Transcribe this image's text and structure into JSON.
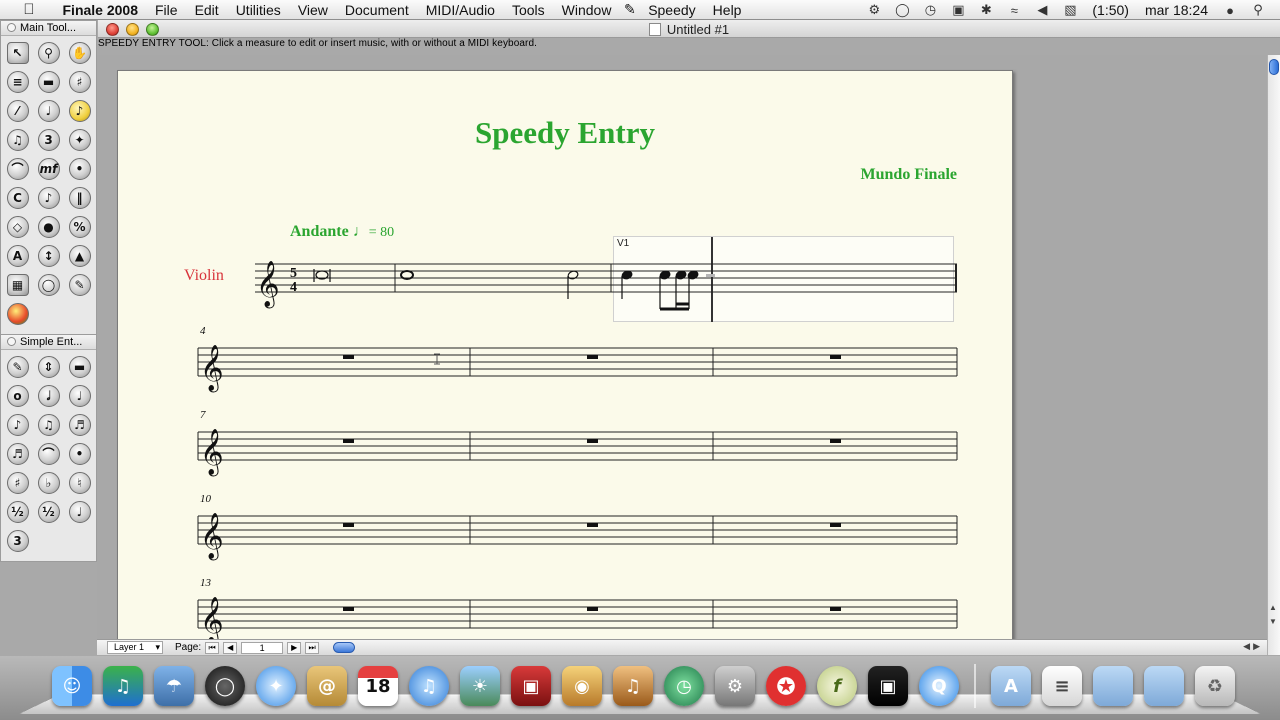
{
  "menubar": {
    "app_name": "Finale 2008",
    "items": [
      "File",
      "Edit",
      "Utilities",
      "View",
      "Document",
      "MIDI/Audio",
      "Tools",
      "Window",
      "Speedy",
      "Help"
    ],
    "battery": "(1:50)",
    "clock": "mar 18:24"
  },
  "message_line": "SPEEDY ENTRY TOOL: Click a measure to edit or insert music, with or without a MIDI keyboard.",
  "window": {
    "title": "Untitled #1"
  },
  "palettes": {
    "main": {
      "title": "Main Tool...",
      "tools": [
        "selection-tool",
        "zoom-tool",
        "hand-grabber-tool",
        "staff-tool",
        "measure-tool",
        "key-signature-tool",
        "time-signature-tool",
        "clef-tool",
        "speedy-entry-tool",
        "simple-entry-tool",
        "tuplet-tool",
        "hyperscribe-tool",
        "smart-shape-tool",
        "expression-tool",
        "articulation-tool",
        "chord-tool",
        "lyrics-tool",
        "repeat-tool",
        "mirror-tool",
        "graphics-tool",
        "page-layout-tool",
        "text-tool",
        "resize-tool",
        "special-tools",
        "midi-tool",
        "note-mover-tool",
        "ossia-tool",
        "color-tool"
      ],
      "active": "speedy-entry-tool"
    },
    "simple": {
      "title": "Simple Ent...",
      "tools": [
        "pencil-tool",
        "eraser-tool",
        "rest-toggle-tool",
        "whole-note",
        "half-note",
        "quarter-note",
        "eighth-note",
        "sixteenth-note",
        "thirty-second-note",
        "sixty-fourth-note",
        "tie-tool",
        "dot-tool",
        "sharp",
        "flat",
        "natural",
        "half-step-up",
        "half-step-down",
        "stem-flip",
        "tuplet"
      ]
    }
  },
  "score": {
    "title": "Speedy Entry",
    "composer": "Mundo Finale",
    "tempo_text": "Andante",
    "tempo_value": "= 80",
    "instrument": "Violin",
    "time_signature_top": "5",
    "time_signature_bottom": "4",
    "measure_numbers": [
      "4",
      "7",
      "10",
      "13"
    ],
    "voice_label": "V1"
  },
  "statusbar": {
    "layer": "Layer 1",
    "page_label": "Page:",
    "page_value": "1"
  },
  "colors": {
    "title_green": "#2ba530",
    "instrument_red": "#d8343b",
    "page_bg": "#fbfaea"
  }
}
